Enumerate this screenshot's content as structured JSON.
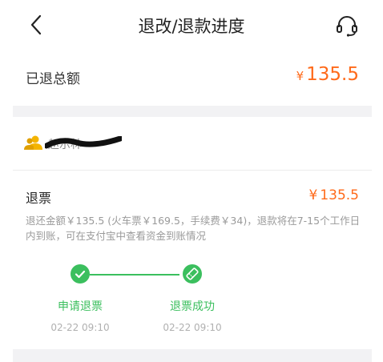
{
  "nav": {
    "title": "退改/退款进度",
    "back_icon": "chevron-left-icon",
    "service_icon": "headset-icon"
  },
  "total": {
    "label": "已退总额",
    "currency": "¥",
    "amount": "135.5"
  },
  "passenger": {
    "icon": "person-icon",
    "name": "赵示林"
  },
  "refund": {
    "title": "退票",
    "currency": "¥",
    "amount": "135.5",
    "description": "退还金额￥135.5 (火车票￥169.5，手续费￥34)，退款将在7-15个工作日内到账，可在支付宝中查看资金到账情况"
  },
  "steps": [
    {
      "label": "申请退票",
      "time": "02-22 09:10",
      "icon": "check-icon"
    },
    {
      "label": "退票成功",
      "time": "02-22 09:10",
      "icon": "ticket-icon"
    }
  ],
  "colors": {
    "accent_orange": "#ff6a1a",
    "success_green": "#3bbf5e"
  }
}
